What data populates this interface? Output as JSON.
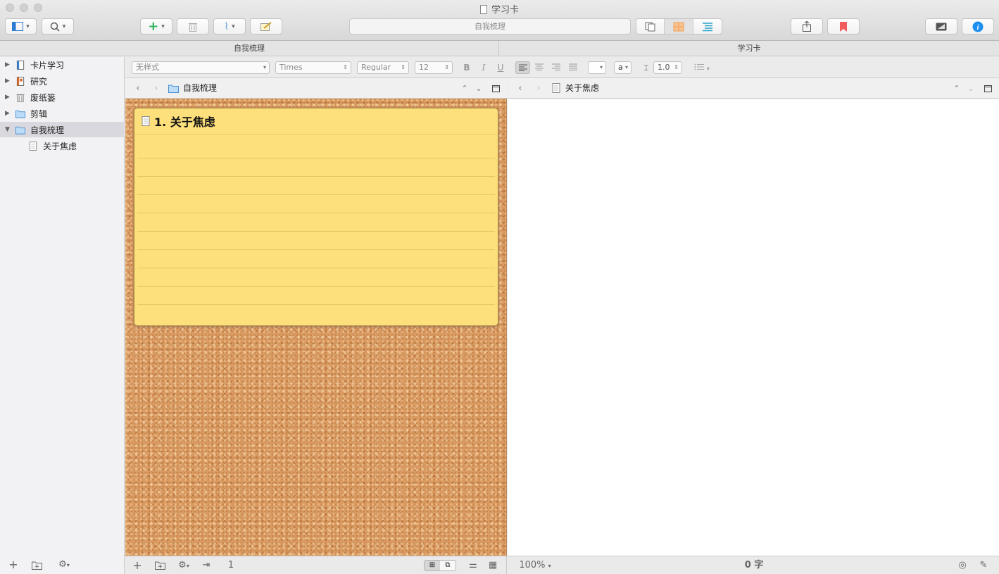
{
  "window": {
    "title": "学习卡"
  },
  "toolbar": {
    "search_field": "自我梳理"
  },
  "header_row": {
    "left": "自我梳理",
    "right": "学习卡"
  },
  "sidebar": {
    "items": [
      {
        "label": "卡片学习",
        "icon": "draft-icon"
      },
      {
        "label": "研究",
        "icon": "research-icon"
      },
      {
        "label": "废纸篓",
        "icon": "trash-icon"
      },
      {
        "label": "剪辑",
        "icon": "folder-icon"
      },
      {
        "label": "自我梳理",
        "icon": "folder-icon"
      },
      {
        "label": "关于焦虑",
        "icon": "document-icon"
      }
    ]
  },
  "formatbar": {
    "style": "无样式",
    "font": "Times",
    "weight": "Regular",
    "size": "12",
    "bold": "B",
    "italic": "I",
    "underline": "U",
    "text_color": "a",
    "line_spacing": "1.0"
  },
  "left_pane": {
    "breadcrumb": "自我梳理",
    "card_title": "1. 关于焦虑",
    "status": "1项"
  },
  "right_pane": {
    "breadcrumb": "关于焦虑",
    "zoom": "100%",
    "word_count": "0 字"
  },
  "colors": {
    "accent_green": "#2fb35a",
    "accent_orange": "#f2a05a",
    "accent_teal": "#2aa3c7",
    "bookmark_red": "#f25b5b",
    "info_blue": "#1d8ff0",
    "card_yellow": "#fde07c"
  }
}
